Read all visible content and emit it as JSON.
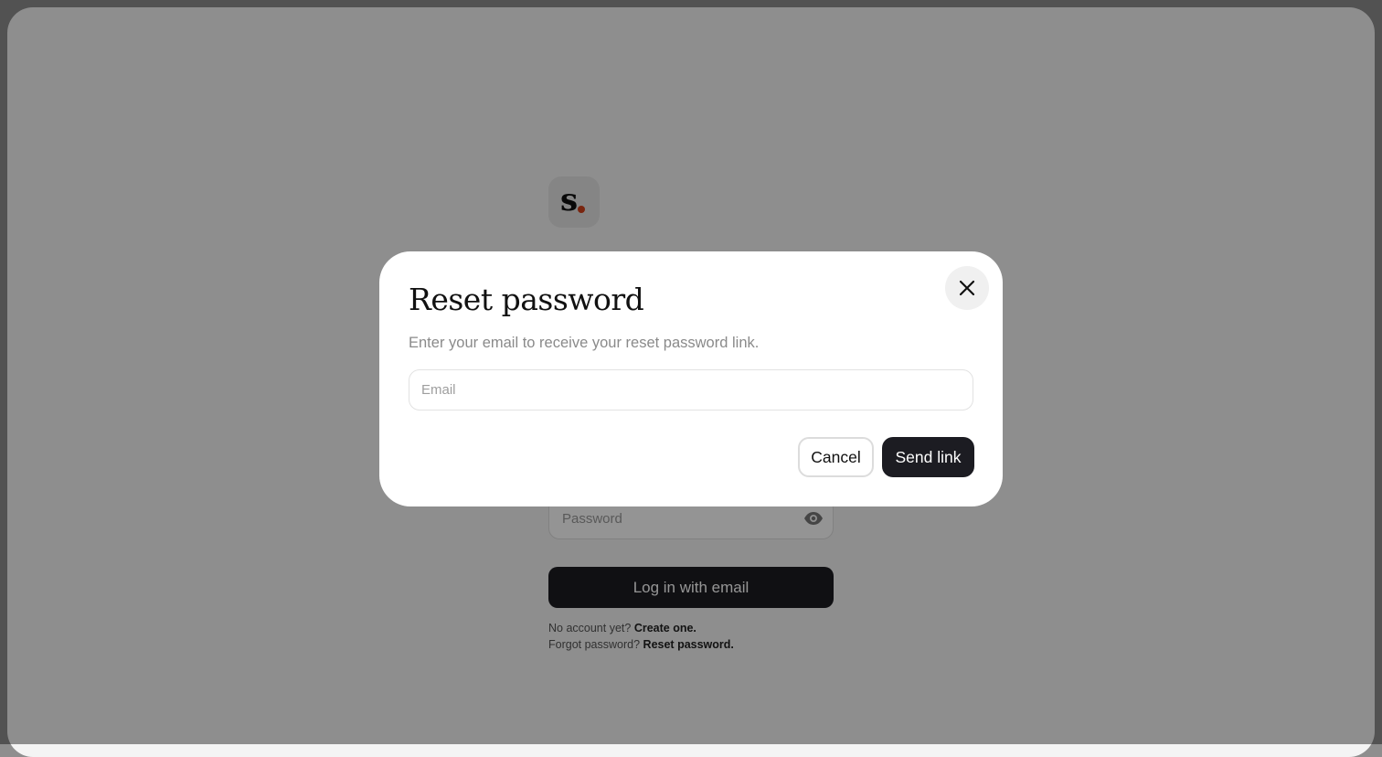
{
  "colors": {
    "primary_button": "#1c1c22",
    "brand_dot": "#d0401b",
    "page_background": "#f4f4f4",
    "overlay": "rgba(0,0,0,0.42)"
  },
  "logo": {
    "letter": "s",
    "icon": "brand-logo-icon"
  },
  "login_form": {
    "password_placeholder": "Password",
    "password_toggle_icon": "eye-icon",
    "submit_label": "Log in with email",
    "no_account_text": "No account yet?",
    "create_link": "Create one.",
    "forgot_text": "Forgot password?",
    "reset_link": "Reset password."
  },
  "modal": {
    "title": "Reset password",
    "description": "Enter your email to receive your reset password link.",
    "email_placeholder": "Email",
    "email_value": "",
    "cancel_label": "Cancel",
    "send_label": "Send link",
    "close_icon": "close-icon"
  }
}
